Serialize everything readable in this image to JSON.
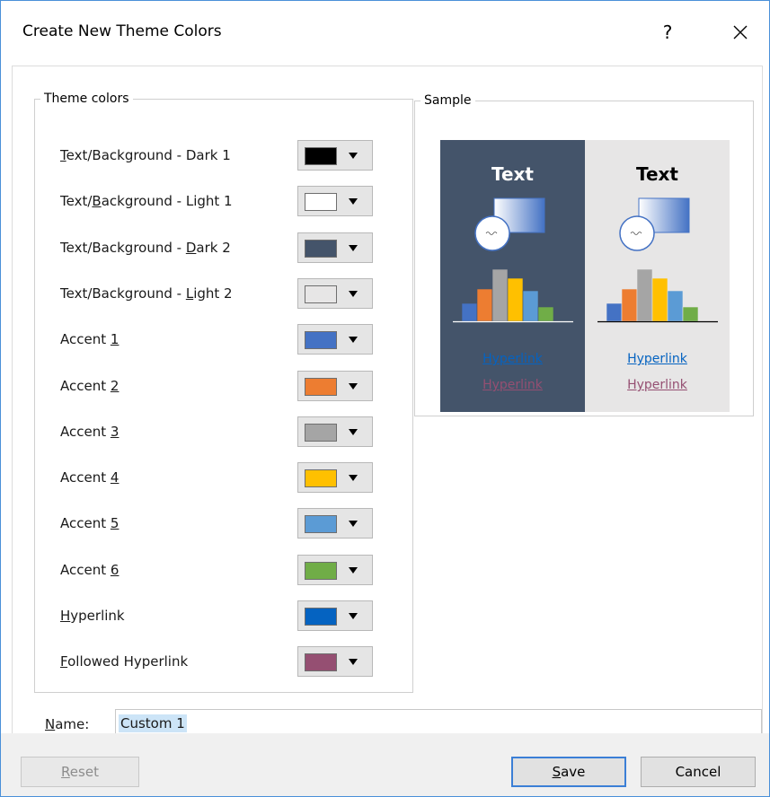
{
  "dialog": {
    "title": "Create New Theme Colors",
    "help_label": "?",
    "close_label": "×"
  },
  "theme_group": {
    "legend": "Theme colors",
    "items": [
      {
        "pre": "",
        "key": "T",
        "post": "ext/Background - Dark 1",
        "color": "#000000"
      },
      {
        "pre": "Text/",
        "key": "B",
        "post": "ackground - Light 1",
        "color": "#ffffff"
      },
      {
        "pre": "Text/Background - ",
        "key": "D",
        "post": "ark 2",
        "color": "#44546a"
      },
      {
        "pre": "Text/Background - ",
        "key": "L",
        "post": "ight 2",
        "color": "#e7e6e6"
      },
      {
        "pre": "Accent ",
        "key": "1",
        "post": "",
        "color": "#4472c4"
      },
      {
        "pre": "Accent ",
        "key": "2",
        "post": "",
        "color": "#ed7d31"
      },
      {
        "pre": "Accent ",
        "key": "3",
        "post": "",
        "color": "#a5a5a5"
      },
      {
        "pre": "Accent ",
        "key": "4",
        "post": "",
        "color": "#ffc000"
      },
      {
        "pre": "Accent ",
        "key": "5",
        "post": "",
        "color": "#5b9bd5"
      },
      {
        "pre": "Accent ",
        "key": "6",
        "post": "",
        "color": "#70ad47"
      },
      {
        "pre": "",
        "key": "H",
        "post": "yperlink",
        "color": "#0563c1"
      },
      {
        "pre": "",
        "key": "F",
        "post": "ollowed Hyperlink",
        "color": "#954f72"
      }
    ]
  },
  "sample_group": {
    "legend": "Sample",
    "dark": {
      "text": "Text",
      "link1": "Hyperlink",
      "link2": "Hyperlink",
      "bg": "#44546a",
      "fg": "#ffffff"
    },
    "light": {
      "text": "Text",
      "link1": "Hyperlink",
      "link2": "Hyperlink",
      "bg": "#e7e6e6",
      "fg": "#000000"
    }
  },
  "name_field": {
    "label_key": "N",
    "label_rest": "ame:",
    "value": "Custom 1"
  },
  "buttons": {
    "reset_key": "R",
    "reset_rest": "eset",
    "save_key": "S",
    "save_rest": "ave",
    "cancel": "Cancel"
  }
}
